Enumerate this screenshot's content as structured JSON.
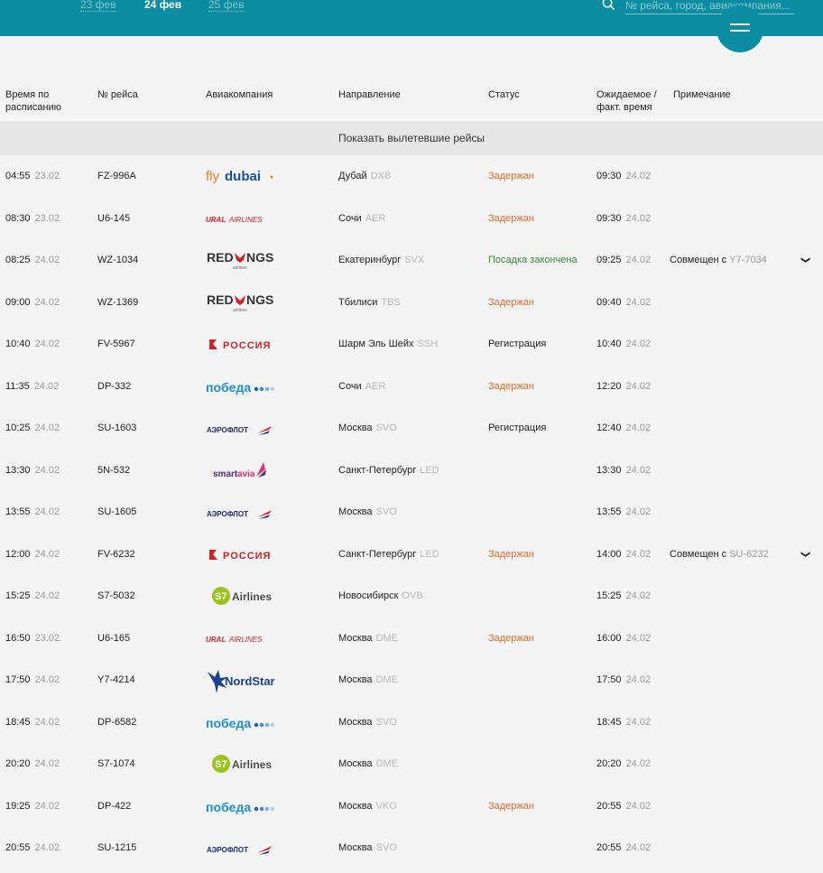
{
  "dates": [
    {
      "label": "23 фев",
      "active": false
    },
    {
      "label": "24 фев",
      "active": true
    },
    {
      "label": "25 фев",
      "active": false
    }
  ],
  "search": {
    "placeholder": "№ рейса, город, авиакомпания..."
  },
  "columns": {
    "sched_1": "Время по",
    "sched_2": "расписанию",
    "flight": "№ рейса",
    "airline": "Авиакомпания",
    "direction": "Направление",
    "status": "Статус",
    "expected_1": "Ожидаемое /",
    "expected_2": "факт. время",
    "note": "Примечание"
  },
  "show_departed": "Показать вылетевшие рейсы",
  "flights": [
    {
      "sched": "04:55",
      "sched_date": "23.02",
      "flight": "FZ-996A",
      "airline": "flydubai",
      "city": "Дубай",
      "code": "DXB",
      "status": "Задержан",
      "status_type": "delayed",
      "exp": "09:30",
      "exp_date": "24.02",
      "note": "",
      "note_code": ""
    },
    {
      "sched": "08:30",
      "sched_date": "23.02",
      "flight": "U6-145",
      "airline": "URAL AIRLINES",
      "city": "Сочи",
      "code": "AER",
      "status": "Задержан",
      "status_type": "delayed",
      "exp": "09:30",
      "exp_date": "24.02",
      "note": "",
      "note_code": ""
    },
    {
      "sched": "08:25",
      "sched_date": "24.02",
      "flight": "WZ-1034",
      "airline": "REDWINGS",
      "city": "Екатеринбург",
      "code": "SVX",
      "status": "Посадка закончена",
      "status_type": "done",
      "exp": "09:25",
      "exp_date": "24.02",
      "note": "Совмещен с",
      "note_code": "Y7-7034"
    },
    {
      "sched": "09:00",
      "sched_date": "24.02",
      "flight": "WZ-1369",
      "airline": "REDWINGS",
      "city": "Тбилиси",
      "code": "TBS",
      "status": "Задержан",
      "status_type": "delayed",
      "exp": "09:40",
      "exp_date": "24.02",
      "note": "",
      "note_code": ""
    },
    {
      "sched": "10:40",
      "sched_date": "24.02",
      "flight": "FV-5967",
      "airline": "РОССИЯ",
      "city": "Шарм Эль Шейх",
      "code": "SSH",
      "status": "Регистрация",
      "status_type": "reg",
      "exp": "10:40",
      "exp_date": "24.02",
      "note": "",
      "note_code": ""
    },
    {
      "sched": "11:35",
      "sched_date": "24.02",
      "flight": "DP-332",
      "airline": "победа",
      "city": "Сочи",
      "code": "AER",
      "status": "Задержан",
      "status_type": "delayed",
      "exp": "12:20",
      "exp_date": "24.02",
      "note": "",
      "note_code": ""
    },
    {
      "sched": "10:25",
      "sched_date": "24.02",
      "flight": "SU-1603",
      "airline": "АЭРОФЛОТ",
      "city": "Москва",
      "code": "SVO",
      "status": "Регистрация",
      "status_type": "reg",
      "exp": "12:40",
      "exp_date": "24.02",
      "note": "",
      "note_code": ""
    },
    {
      "sched": "13:30",
      "sched_date": "24.02",
      "flight": "5N-532",
      "airline": "smartavia",
      "city": "Санкт-Петербург",
      "code": "LED",
      "status": "",
      "status_type": "",
      "exp": "13:30",
      "exp_date": "24.02",
      "note": "",
      "note_code": ""
    },
    {
      "sched": "13:55",
      "sched_date": "24.02",
      "flight": "SU-1605",
      "airline": "АЭРОФЛОТ",
      "city": "Москва",
      "code": "SVO",
      "status": "",
      "status_type": "",
      "exp": "13:55",
      "exp_date": "24.02",
      "note": "",
      "note_code": ""
    },
    {
      "sched": "12:00",
      "sched_date": "24.02",
      "flight": "FV-6232",
      "airline": "РОССИЯ",
      "city": "Санкт-Петербург",
      "code": "LED",
      "status": "Задержан",
      "status_type": "delayed",
      "exp": "14:00",
      "exp_date": "24.02",
      "note": "Совмещен с",
      "note_code": "SU-6232"
    },
    {
      "sched": "15:25",
      "sched_date": "24.02",
      "flight": "S7-5032",
      "airline": "S7 Airlines",
      "city": "Новосибирск",
      "code": "OVB",
      "status": "",
      "status_type": "",
      "exp": "15:25",
      "exp_date": "24.02",
      "note": "",
      "note_code": ""
    },
    {
      "sched": "16:50",
      "sched_date": "23.02",
      "flight": "U6-165",
      "airline": "URAL AIRLINES",
      "city": "Москва",
      "code": "DME",
      "status": "Задержан",
      "status_type": "delayed",
      "exp": "16:00",
      "exp_date": "24.02",
      "note": "",
      "note_code": ""
    },
    {
      "sched": "17:50",
      "sched_date": "24.02",
      "flight": "Y7-4214",
      "airline": "NordStar",
      "city": "Москва",
      "code": "DME",
      "status": "",
      "status_type": "",
      "exp": "17:50",
      "exp_date": "24.02",
      "note": "",
      "note_code": ""
    },
    {
      "sched": "18:45",
      "sched_date": "24.02",
      "flight": "DP-6582",
      "airline": "победа",
      "city": "Москва",
      "code": "SVO",
      "status": "",
      "status_type": "",
      "exp": "18:45",
      "exp_date": "24.02",
      "note": "",
      "note_code": ""
    },
    {
      "sched": "20:20",
      "sched_date": "24.02",
      "flight": "S7-1074",
      "airline": "S7 Airlines",
      "city": "Москва",
      "code": "DME",
      "status": "",
      "status_type": "",
      "exp": "20:20",
      "exp_date": "24.02",
      "note": "",
      "note_code": ""
    },
    {
      "sched": "19:25",
      "sched_date": "24.02",
      "flight": "DP-422",
      "airline": "победа",
      "city": "Москва",
      "code": "VKO",
      "status": "Задержан",
      "status_type": "delayed",
      "exp": "20:55",
      "exp_date": "24.02",
      "note": "",
      "note_code": ""
    },
    {
      "sched": "20:55",
      "sched_date": "24.02",
      "flight": "SU-1215",
      "airline": "АЭРОФЛОТ",
      "city": "Москва",
      "code": "SVO",
      "status": "",
      "status_type": "",
      "exp": "20:55",
      "exp_date": "24.02",
      "note": "",
      "note_code": ""
    }
  ],
  "colors": {
    "accent": "#0a8ca1",
    "delayed": "#e36b2c",
    "done": "#3a8a3a",
    "background": "#f4f4f4",
    "band": "#e6e6e6"
  }
}
